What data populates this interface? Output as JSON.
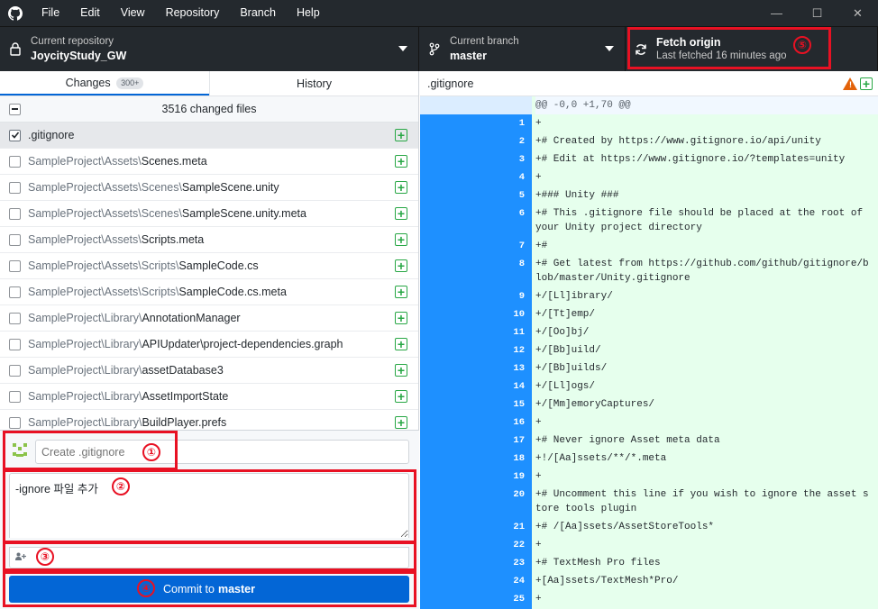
{
  "menu": [
    "File",
    "Edit",
    "View",
    "Repository",
    "Branch",
    "Help"
  ],
  "window_controls": {
    "minimize": "—",
    "maximize": "☐",
    "close": "✕"
  },
  "toolbar": {
    "repo_label": "Current repository",
    "repo_name": "JoycityStudy_GW",
    "branch_label": "Current branch",
    "branch_name": "master",
    "fetch_title": "Fetch origin",
    "fetch_sub": "Last fetched 16 minutes ago"
  },
  "tabs": {
    "changes": "Changes",
    "changes_count": "300+",
    "history": "History"
  },
  "changes": {
    "summary": "3516 changed files",
    "files": [
      {
        "dir": "",
        "name": ".gitignore",
        "checked": true,
        "selected": true
      },
      {
        "dir": "SampleProject\\Assets\\",
        "name": "Scenes.meta",
        "checked": false
      },
      {
        "dir": "SampleProject\\Assets\\Scenes\\",
        "name": "SampleScene.unity",
        "checked": false
      },
      {
        "dir": "SampleProject\\Assets\\Scenes\\",
        "name": "SampleScene.unity.meta",
        "checked": false
      },
      {
        "dir": "SampleProject\\Assets\\",
        "name": "Scripts.meta",
        "checked": false
      },
      {
        "dir": "SampleProject\\Assets\\Scripts\\",
        "name": "SampleCode.cs",
        "checked": false
      },
      {
        "dir": "SampleProject\\Assets\\Scripts\\",
        "name": "SampleCode.cs.meta",
        "checked": false
      },
      {
        "dir": "SampleProject\\Library\\",
        "name": "AnnotationManager",
        "checked": false
      },
      {
        "dir": "SampleProject\\Library\\",
        "name": "APIUpdater\\project-dependencies.graph",
        "checked": false
      },
      {
        "dir": "SampleProject\\Library\\",
        "name": "assetDatabase3",
        "checked": false
      },
      {
        "dir": "SampleProject\\Library\\",
        "name": "AssetImportState",
        "checked": false
      },
      {
        "dir": "SampleProject\\Library\\",
        "name": "BuildPlayer.prefs",
        "checked": false
      }
    ]
  },
  "commit": {
    "summary_placeholder": "Create .gitignore",
    "description": "-ignore 파일 추가",
    "button_prefix": "Commit to",
    "button_branch": "master"
  },
  "diff": {
    "filename": ".gitignore",
    "hunk": "@@ -0,0 +1,70 @@",
    "lines": [
      {
        "n": "1",
        "text": "+"
      },
      {
        "n": "2",
        "text": "+# Created by https://www.gitignore.io/api/unity"
      },
      {
        "n": "3",
        "text": "+# Edit at https://www.gitignore.io/?templates=unity"
      },
      {
        "n": "4",
        "text": "+"
      },
      {
        "n": "5",
        "text": "+### Unity ###"
      },
      {
        "n": "6",
        "text": "+# This .gitignore file should be placed at the root of your Unity project directory",
        "wrap": true
      },
      {
        "n": "7",
        "text": "+#"
      },
      {
        "n": "8",
        "text": "+# Get latest from https://github.com/github/gitignore/blob/master/Unity.gitignore",
        "wrap": true
      },
      {
        "n": "9",
        "text": "+/[Ll]ibrary/"
      },
      {
        "n": "10",
        "text": "+/[Tt]emp/"
      },
      {
        "n": "11",
        "text": "+/[Oo]bj/"
      },
      {
        "n": "12",
        "text": "+/[Bb]uild/"
      },
      {
        "n": "13",
        "text": "+/[Bb]uilds/"
      },
      {
        "n": "14",
        "text": "+/[Ll]ogs/"
      },
      {
        "n": "15",
        "text": "+/[Mm]emoryCaptures/"
      },
      {
        "n": "16",
        "text": "+"
      },
      {
        "n": "17",
        "text": "+# Never ignore Asset meta data"
      },
      {
        "n": "18",
        "text": "+!/[Aa]ssets/**/*.meta"
      },
      {
        "n": "19",
        "text": "+"
      },
      {
        "n": "20",
        "text": "+# Uncomment this line if you wish to ignore the asset store tools plugin",
        "wrap": true
      },
      {
        "n": "21",
        "text": "+# /[Aa]ssets/AssetStoreTools*"
      },
      {
        "n": "22",
        "text": "+"
      },
      {
        "n": "23",
        "text": "+# TextMesh Pro files"
      },
      {
        "n": "24",
        "text": "+[Aa]ssets/TextMesh*Pro/"
      },
      {
        "n": "25",
        "text": "+"
      }
    ]
  },
  "annotations": [
    "①",
    "②",
    "③",
    "④",
    "⑤"
  ],
  "colors": {
    "accent": "#0366d6",
    "annotation": "#e81123",
    "diff_add_bg": "#e6ffed",
    "gutter": "#1e90ff"
  }
}
